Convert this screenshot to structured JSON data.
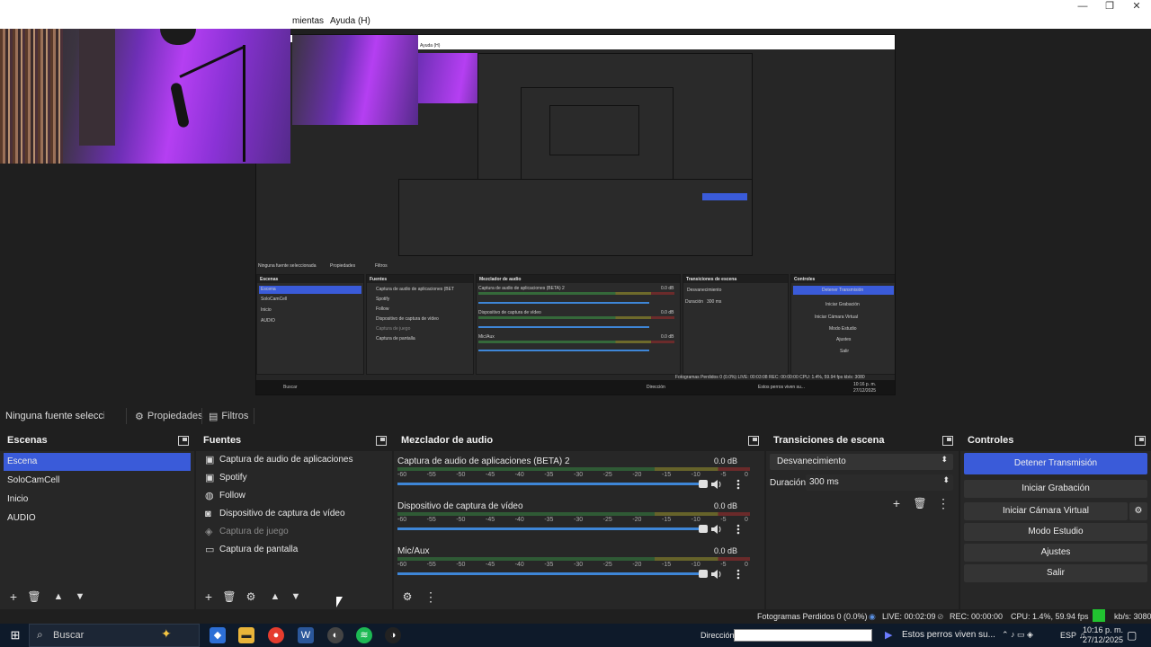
{
  "window": {
    "menu_items": [
      "mientas",
      "Ayuda (H)"
    ]
  },
  "source_toolbar": {
    "no_source": "Ninguna fuente seleccionad",
    "properties": "Propiedades",
    "filters": "Filtros"
  },
  "scenes": {
    "title": "Escenas",
    "items": [
      "Escena",
      "SoloCamCell",
      "Inicio",
      "AUDIO"
    ],
    "selected": "Escena"
  },
  "sources": {
    "title": "Fuentes",
    "items": [
      {
        "name": "Captura de audio de aplicaciones (BET",
        "icon": "audio-app-icon"
      },
      {
        "name": "Spotify",
        "icon": "window-capture-icon"
      },
      {
        "name": "Follow",
        "icon": "browser-icon"
      },
      {
        "name": "Dispositivo de captura de vídeo",
        "icon": "camera-icon"
      },
      {
        "name": "Captura de juego",
        "icon": "gamepad-icon"
      },
      {
        "name": "Captura de pantalla",
        "icon": "monitor-icon"
      }
    ]
  },
  "mixer": {
    "title": "Mezclador de audio",
    "channels": [
      {
        "name": "Captura de audio de aplicaciones (BETA) 2",
        "db": "0.0 dB"
      },
      {
        "name": "Dispositivo de captura de vídeo",
        "db": "0.0 dB"
      },
      {
        "name": "Mic/Aux",
        "db": "0.0 dB"
      }
    ],
    "ticks": [
      "-60",
      "-55",
      "-50",
      "-45",
      "-40",
      "-35",
      "-30",
      "-25",
      "-20",
      "-15",
      "-10",
      "-5",
      "0"
    ]
  },
  "transitions": {
    "title": "Transiciones de escena",
    "selected": "Desvanecimiento",
    "duration_label": "Duración",
    "duration_value": "300 ms"
  },
  "controls": {
    "title": "Controles",
    "buttons": [
      "Detener Transmisión",
      "Iniciar Grabación",
      "Iniciar Cámara Virtual",
      "Modo Estudio",
      "Ajustes",
      "Salir"
    ]
  },
  "status": {
    "dropped": "Fotogramas Perdidos 0 (0.0%)",
    "live": "LIVE: 00:02:09",
    "rec": "REC: 00:00:00",
    "cpu": "CPU: 1.4%, 59.94 fps",
    "bitrate": "kb/s: 3080"
  },
  "taskbar": {
    "search_placeholder": "Buscar",
    "address_label": "Dirección",
    "now_playing": "Estos perros viven su...",
    "language": "ESP",
    "time": "10:16 p. m.",
    "date": "27/12/2025"
  },
  "nested_preview": {
    "menu": "Ayuda (H)",
    "no_source": "Ninguna fuente seleccionada",
    "properties": "Propiedades",
    "filters": "Filtros",
    "scenes_title": "Escenas",
    "sources_title": "Fuentes",
    "mixer_title": "Mezclador de audio",
    "transitions_title": "Transiciones de escena",
    "controls_title": "Controles",
    "scenes": [
      "Escena",
      "SoloCamCell",
      "Inicio",
      "AUDIO"
    ],
    "sources": [
      "Captura de audio de aplicaciones (BET",
      "Spotify",
      "Follow",
      "Dispositivo de captura de vídeo",
      "Captura de juego",
      "Captura de pantalla"
    ],
    "channels": [
      "Captura de audio de aplicaciones (BETA) 2",
      "Dispositivo de captura de vídeo",
      "Mic/Aux"
    ],
    "db": "0.0 dB",
    "transition": "Desvanecimiento",
    "duration_label": "Duración",
    "duration": "300 ms",
    "buttons": [
      "Detener Transmisión",
      "Iniciar Grabación",
      "Iniciar Cámara Virtual",
      "Modo Estudio",
      "Ajustes",
      "Salir"
    ],
    "status": "Fotogramas Perdidos 0 (0.0%)   LIVE: 00:03:08   REC: 00:00:00   CPU: 1.4%, 59.94 fps   kb/s: 3080",
    "search": "Buscar",
    "address": "Dirección",
    "now_playing": "Estos perros viven su...",
    "time": "10:16 p. m.",
    "date": "27/12/2025"
  },
  "colors": {
    "accent": "#3a5bd9",
    "live_indicator": "#21c230",
    "panel": "#272727",
    "header": "#1f1f1f"
  }
}
